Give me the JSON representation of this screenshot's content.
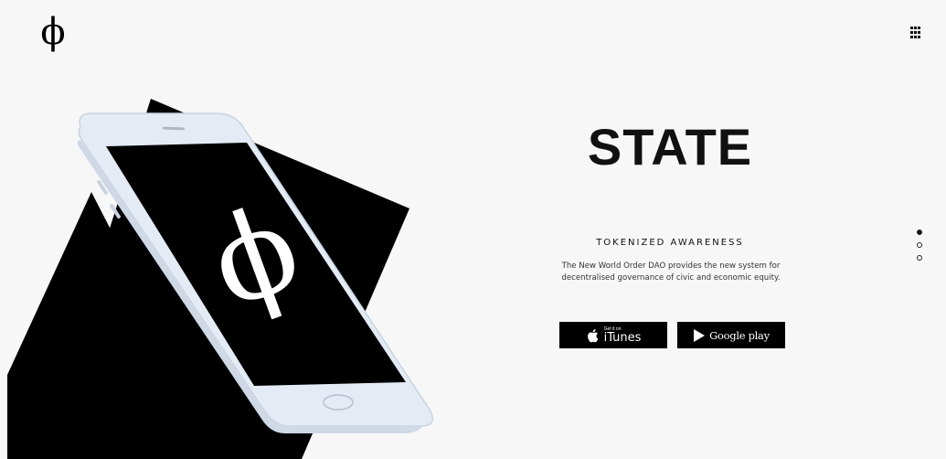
{
  "header": {
    "logo_glyph": "ϕ",
    "menu_icon": "grid-menu-icon"
  },
  "hero": {
    "phone_screen_glyph": "ϕ",
    "title": "STATE",
    "subtitle": "TOKENIZED AWARENESS",
    "description": "The New World Order DAO provides the new system for decentralised governance of civic and economic equity.",
    "buttons": {
      "itunes_small": "Get it on",
      "itunes_big": "iTunes",
      "google": "Google play"
    }
  },
  "pagination": {
    "count": 3,
    "active_index": 0
  },
  "colors": {
    "background": "#f7f7f7",
    "accent": "#000000",
    "phone_body": "#e3eaf3"
  }
}
